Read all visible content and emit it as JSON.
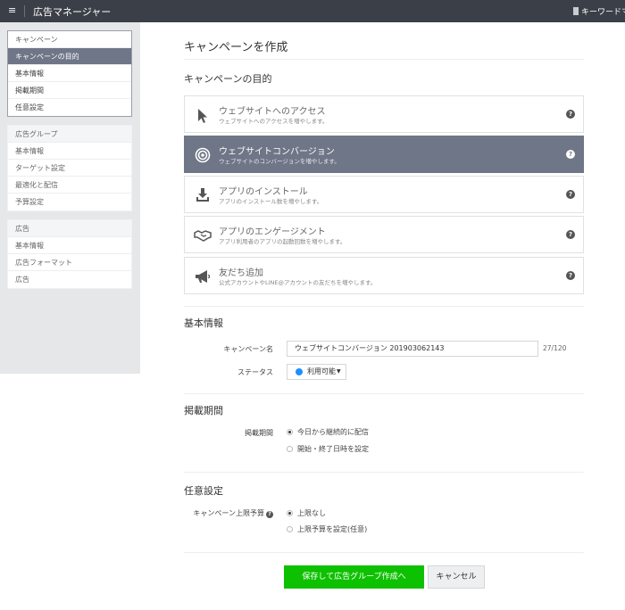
{
  "topbar": {
    "menu_icon": "≡",
    "title": "広告マネージャー",
    "keyword_tool": "キーワードマ"
  },
  "sidebar": {
    "campaign": {
      "header": "キャンペーン",
      "items": [
        "キャンペーンの目的",
        "基本情報",
        "掲載期間",
        "任意設定"
      ]
    },
    "adgroup": {
      "header": "広告グループ",
      "items": [
        "基本情報",
        "ターゲット設定",
        "最適化と配信",
        "予算設定"
      ]
    },
    "ad": {
      "header": "広告",
      "items": [
        "基本情報",
        "広告フォーマット",
        "広告"
      ]
    }
  },
  "main": {
    "page_title": "キャンペーンを作成",
    "objective_heading": "キャンペーンの目的",
    "objectives": [
      {
        "title": "ウェブサイトへのアクセス",
        "subtitle": "ウェブサイトへのアクセスを増やします。",
        "icon": "cursor-icon"
      },
      {
        "title": "ウェブサイトコンバージョン",
        "subtitle": "ウェブサイトのコンバージョンを増やします。",
        "icon": "target-icon"
      },
      {
        "title": "アプリのインストール",
        "subtitle": "アプリのインストール数を増やします。",
        "icon": "download-icon"
      },
      {
        "title": "アプリのエンゲージメント",
        "subtitle": "アプリ利用者のアプリの起動回数を増やします。",
        "icon": "handshake-icon"
      },
      {
        "title": "友だち追加",
        "subtitle": "公式アカウントやLINE@アカウントの友だちを増やします。",
        "icon": "megaphone-icon"
      }
    ],
    "help_glyph": "?",
    "basic_heading": "基本情報",
    "campaign_name_label": "キャンペーン名",
    "campaign_name_value": "ウェブサイトコンバージョン 201903062143",
    "char_count": "27/120",
    "status_label": "ステータス",
    "status_value": "利用可能",
    "status_caret": "▼",
    "period_heading": "掲載期間",
    "period_label": "掲載期間",
    "period_options": [
      "今日から継続的に配信",
      "開始・終了日時を設定"
    ],
    "optional_heading": "任意設定",
    "budget_label": "キャンペーン上限予算",
    "budget_options": [
      "上限なし",
      "上限予算を設定(任意)"
    ],
    "save_button": "保存して広告グループ作成へ",
    "cancel_button": "キャンセル"
  },
  "colors": {
    "topbar": "#3b3f47",
    "selected": "#6e7687",
    "save": "#0ec100",
    "status_dot": "#1e90ff"
  }
}
